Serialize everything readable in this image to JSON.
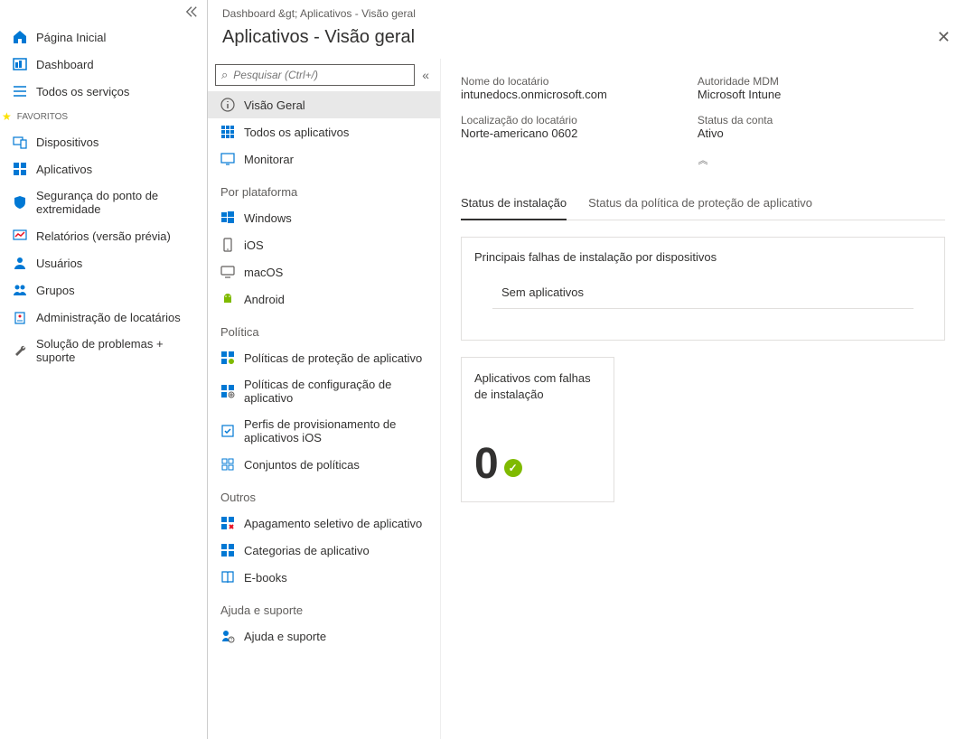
{
  "sidebar": {
    "home": "Página Inicial",
    "dashboard": "Dashboard",
    "all_services": "Todos os serviços",
    "favorites_label": "FAVORITOS",
    "devices": "Dispositivos",
    "apps": "Aplicativos",
    "endpoint_security": "Segurança do ponto de extremidade",
    "reports": "Relatórios (versão prévia)",
    "users": "Usuários",
    "groups": "Grupos",
    "tenant_admin": "Administração de locatários",
    "troubleshoot": "Solução de problemas + suporte"
  },
  "breadcrumb": "Dashboard &gt;   Aplicativos - Visão geral",
  "page_title": "Aplicativos - Visão geral",
  "search_placeholder": "Pesquisar (Ctrl+/)",
  "submenu": {
    "overview": "Visão Geral",
    "all_apps": "Todos os aplicativos",
    "monitor": "Monitorar",
    "by_platform": "Por plataforma",
    "windows": "Windows",
    "ios": "iOS",
    "macos": "macOS",
    "android": "Android",
    "policy": "Política",
    "app_protection": "Políticas de proteção de aplicativo",
    "app_config": "Políticas de configuração de aplicativo",
    "ios_provision": "Perfis de provisionamento de aplicativos iOS",
    "policy_sets": "Conjuntos de políticas",
    "others": "Outros",
    "selective_wipe": "Apagamento seletivo de aplicativo",
    "categories": "Categorias de aplicativo",
    "ebooks": "E-books",
    "help_header": "Ajuda e suporte",
    "help": "Ajuda e suporte"
  },
  "tenant": {
    "name_label": "Nome do locatário",
    "name_value": "intunedocs.onmicrosoft.com",
    "location_label": "Localização do locatário",
    "location_value": "Norte-americano 0602",
    "mdm_label": "Autoridade MDM",
    "mdm_value": "Microsoft Intune",
    "status_label": "Status da conta",
    "status_value": "Ativo"
  },
  "tabs": {
    "install_status": "Status de instalação",
    "protection_status": "Status da política de proteção de aplicativo"
  },
  "cards": {
    "failures_title": "Principais falhas de instalação por dispositivos",
    "no_apps": "Sem aplicativos",
    "install_fail_title": "Aplicativos com falhas de instalação",
    "install_fail_count": "0"
  }
}
